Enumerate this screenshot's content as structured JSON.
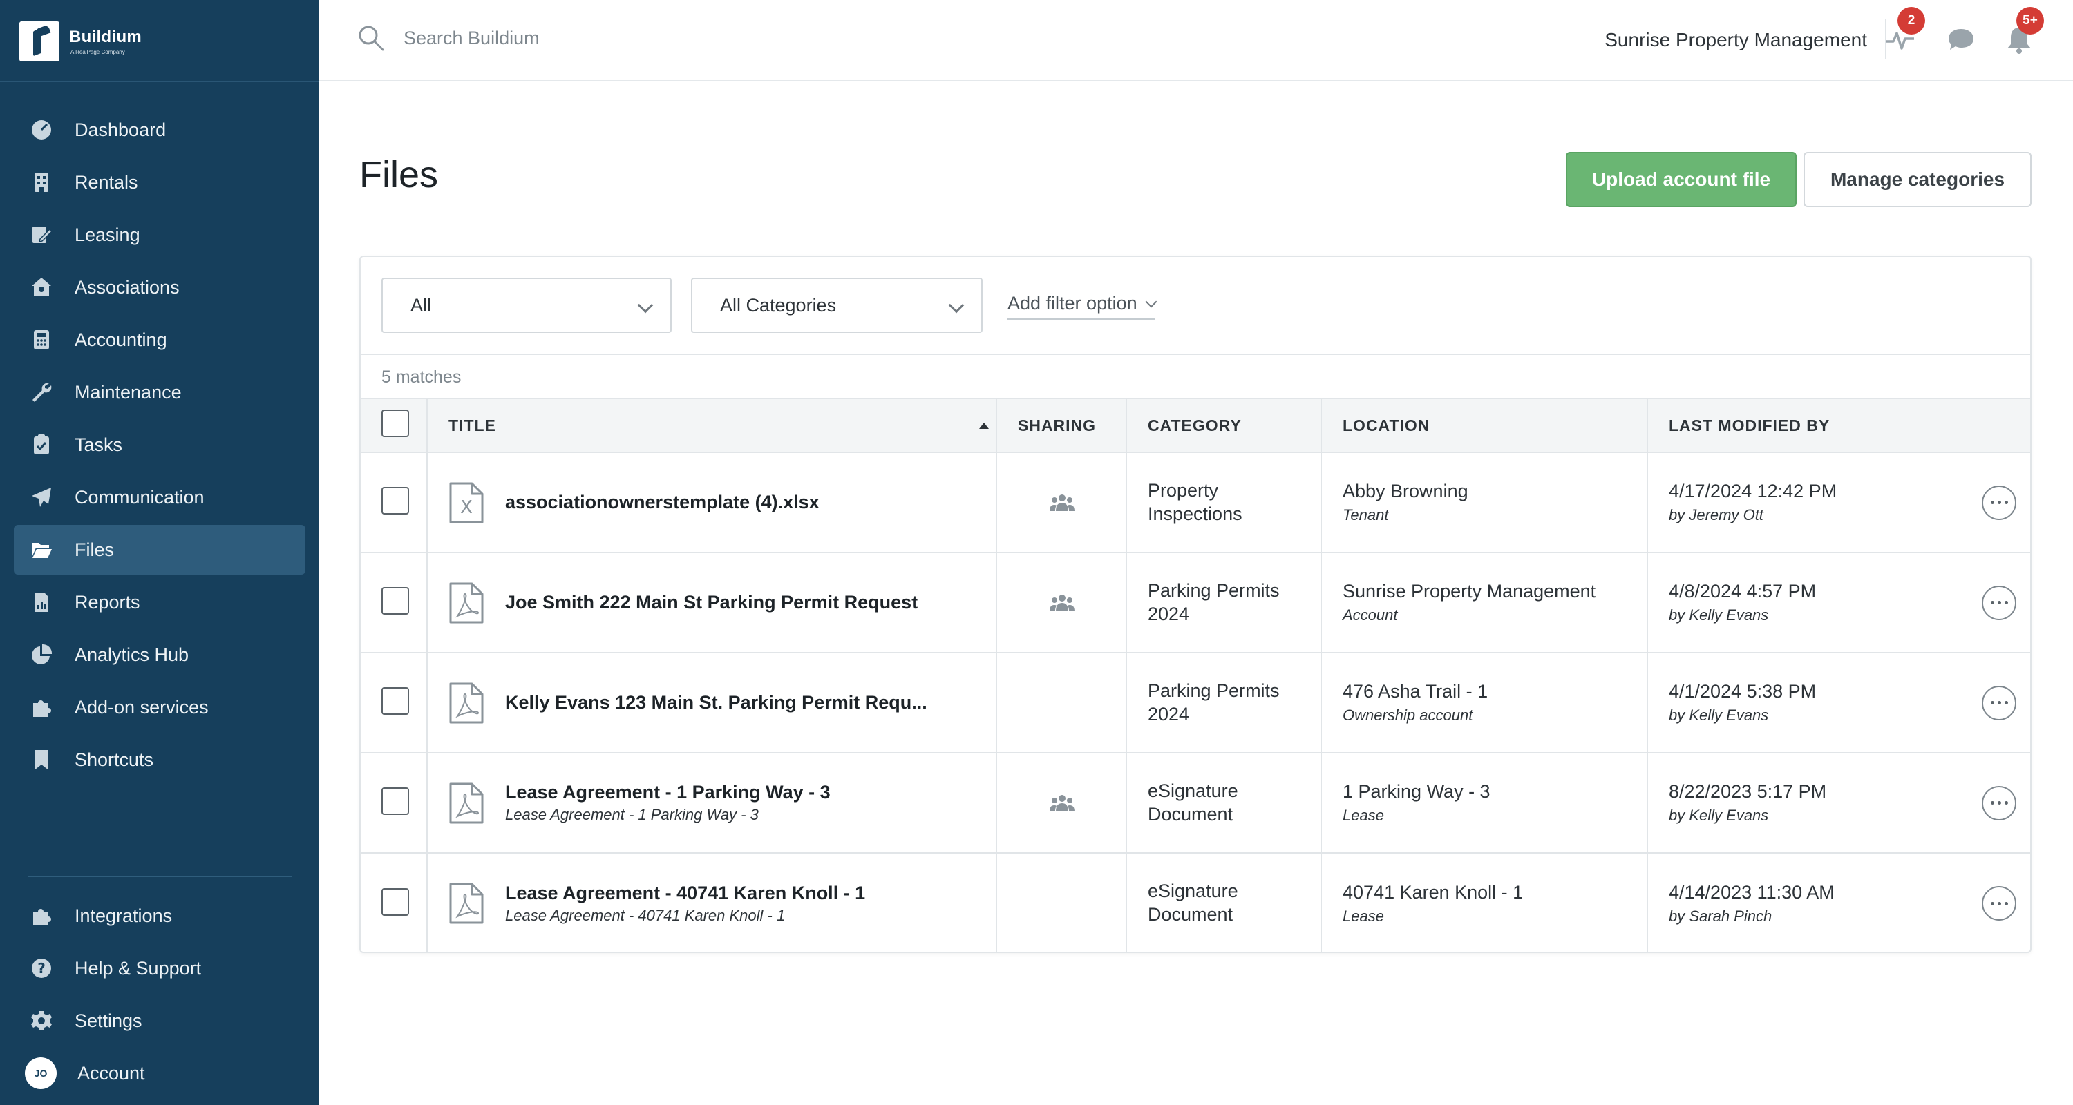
{
  "brand": {
    "name": "Buildium",
    "tagline": "A RealPage Company"
  },
  "sidebar": {
    "items": [
      {
        "label": "Dashboard",
        "icon": "dashboard-icon",
        "active": false
      },
      {
        "label": "Rentals",
        "icon": "building-icon",
        "active": false
      },
      {
        "label": "Leasing",
        "icon": "lease-sign-icon",
        "active": false
      },
      {
        "label": "Associations",
        "icon": "association-icon",
        "active": false
      },
      {
        "label": "Accounting",
        "icon": "calculator-icon",
        "active": false
      },
      {
        "label": "Maintenance",
        "icon": "wrench-icon",
        "active": false
      },
      {
        "label": "Tasks",
        "icon": "clipboard-check-icon",
        "active": false
      },
      {
        "label": "Communication",
        "icon": "paper-plane-icon",
        "active": false
      },
      {
        "label": "Files",
        "icon": "folder-open-icon",
        "active": true
      },
      {
        "label": "Reports",
        "icon": "report-icon",
        "active": false
      },
      {
        "label": "Analytics Hub",
        "icon": "pie-chart-icon",
        "active": false
      },
      {
        "label": "Add-on services",
        "icon": "puzzle-icon",
        "active": false
      },
      {
        "label": "Shortcuts",
        "icon": "bookmark-icon",
        "active": false
      }
    ],
    "bottom_items": [
      {
        "label": "Integrations",
        "icon": "puzzle-icon"
      },
      {
        "label": "Help & Support",
        "icon": "help-icon"
      },
      {
        "label": "Settings",
        "icon": "gear-icon"
      },
      {
        "label": "Account",
        "icon": "avatar"
      }
    ],
    "avatar_initials": "JO"
  },
  "topbar": {
    "search_placeholder": "Search Buildium",
    "org_name": "Sunrise Property Management",
    "activity_badge": "2",
    "notifications_badge": "5+"
  },
  "page": {
    "title": "Files",
    "upload_button": "Upload account file",
    "manage_button": "Manage categories"
  },
  "filters": {
    "scope": "All",
    "category": "All Categories",
    "add_filter": "Add filter option",
    "matches": "5 matches"
  },
  "table": {
    "headers": {
      "title": "TITLE",
      "sharing": "SHARING",
      "category": "CATEGORY",
      "location": "LOCATION",
      "modified": "LAST MODIFIED BY"
    },
    "rows": [
      {
        "file_type": "excel",
        "title": "associationownerstemplate (4).xlsx",
        "subtitle": "",
        "shared": true,
        "category": "Property Inspections",
        "location": "Abby Browning",
        "location_type": "Tenant",
        "modified": "4/17/2024 12:42 PM",
        "modified_by": "by Jeremy Ott"
      },
      {
        "file_type": "pdf",
        "title": "Joe Smith 222 Main St Parking Permit Request",
        "subtitle": "",
        "shared": true,
        "category": "Parking Permits 2024",
        "location": "Sunrise Property Management",
        "location_type": "Account",
        "modified": "4/8/2024 4:57 PM",
        "modified_by": "by Kelly Evans"
      },
      {
        "file_type": "pdf",
        "title": "Kelly Evans 123 Main St. Parking Permit Requ...",
        "subtitle": "",
        "shared": false,
        "category": "Parking Permits 2024",
        "location": "476 Asha Trail - 1",
        "location_type": "Ownership account",
        "modified": "4/1/2024 5:38 PM",
        "modified_by": "by Kelly Evans"
      },
      {
        "file_type": "pdf",
        "title": "Lease Agreement - 1 Parking Way - 3",
        "subtitle": "Lease Agreement - 1 Parking Way - 3",
        "shared": true,
        "category": "eSignature Document",
        "location": "1 Parking Way - 3",
        "location_type": "Lease",
        "modified": "8/22/2023 5:17 PM",
        "modified_by": "by Kelly Evans"
      },
      {
        "file_type": "pdf",
        "title": "Lease Agreement - 40741 Karen Knoll - 1",
        "subtitle": "Lease Agreement - 40741 Karen Knoll - 1",
        "shared": false,
        "category": "eSignature Document",
        "location": "40741 Karen Knoll - 1",
        "location_type": "Lease",
        "modified": "4/14/2023 11:30 AM",
        "modified_by": "by Sarah Pinch"
      }
    ]
  },
  "colors": {
    "sidebar_bg": "#163f5c",
    "sidebar_active": "#2e5c7c",
    "primary_button": "#6ab673",
    "badge": "#d43c35"
  }
}
